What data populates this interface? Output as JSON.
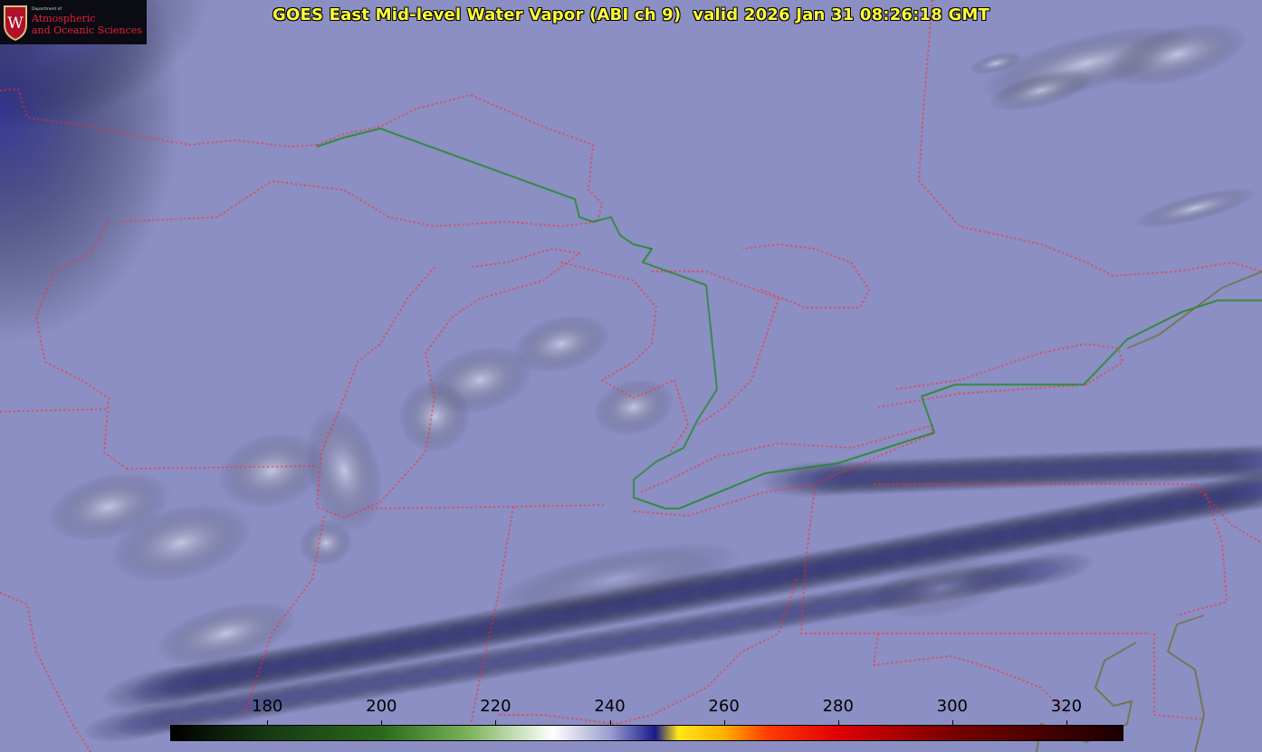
{
  "title": "GOES East Mid-level Water Vapor (ABI ch 9)  valid 2026 Jan 31 08:26:18 GMT",
  "logo": {
    "dept": "Department of",
    "line1": "Atmospheric",
    "line2": "and Oceanic Sciences",
    "crest_letter": "W"
  },
  "colorbar": {
    "min": 163,
    "max": 330,
    "ticks": [
      "180",
      "200",
      "220",
      "240",
      "260",
      "280",
      "300",
      "320"
    ],
    "stops": [
      {
        "t": 163,
        "c": "#000000"
      },
      {
        "t": 180,
        "c": "#173a14"
      },
      {
        "t": 200,
        "c": "#2a6a1c"
      },
      {
        "t": 215,
        "c": "#7ab25a"
      },
      {
        "t": 230,
        "c": "#ffffff"
      },
      {
        "t": 240,
        "c": "#9c9fd0"
      },
      {
        "t": 248,
        "c": "#1a1a8a"
      },
      {
        "t": 252,
        "c": "#ffe818"
      },
      {
        "t": 260,
        "c": "#ffb000"
      },
      {
        "t": 268,
        "c": "#ff3a00"
      },
      {
        "t": 280,
        "c": "#e00000"
      },
      {
        "t": 300,
        "c": "#7a0000"
      },
      {
        "t": 330,
        "c": "#1a0000"
      }
    ]
  },
  "colors": {
    "title": "#ffff3a",
    "background": "#8c8fc4",
    "dry_band": "#3a3c9a",
    "moist_cloud": "#f2f3ff",
    "state_border": "#ff2a2a",
    "intl_border": "#138a13",
    "coast": "#ff2a2a"
  }
}
